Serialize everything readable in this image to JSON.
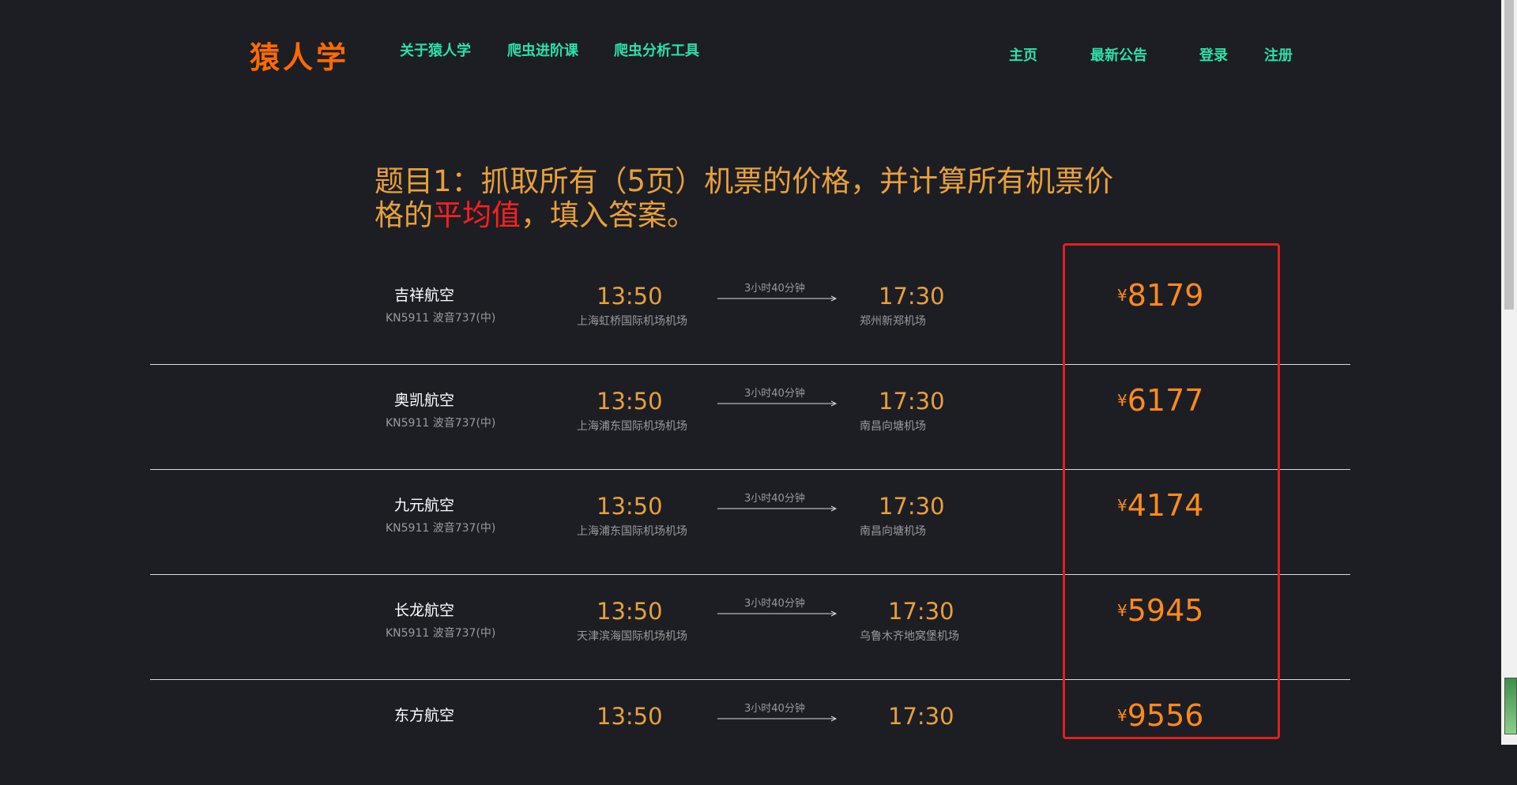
{
  "header": {
    "logo": "猿人学",
    "nav_left": [
      "关于猿人学",
      "爬虫进阶课",
      "爬虫分析工具"
    ],
    "nav_right": [
      "主页",
      "最新公告",
      "登录",
      "注册"
    ]
  },
  "question": {
    "prefix": "题目1：抓取所有（5页）机票的价格，并计算所有机票价格的",
    "emphasis": "平均值",
    "suffix": "，填入答案。"
  },
  "flights": [
    {
      "airline": "吉祥航空",
      "flight_no": "KN5911 波音737(中)",
      "dep_time": "13:50",
      "dep_airport": "上海虹桥国际机场机场",
      "duration": "3小时40分钟",
      "arr_time": "17:30",
      "arr_airport": "郑州新郑机场",
      "currency": "¥",
      "price": "8179"
    },
    {
      "airline": "奥凯航空",
      "flight_no": "KN5911 波音737(中)",
      "dep_time": "13:50",
      "dep_airport": "上海浦东国际机场机场",
      "duration": "3小时40分钟",
      "arr_time": "17:30",
      "arr_airport": "南昌向塘机场",
      "currency": "¥",
      "price": "6177"
    },
    {
      "airline": "九元航空",
      "flight_no": "KN5911 波音737(中)",
      "dep_time": "13:50",
      "dep_airport": "上海浦东国际机场机场",
      "duration": "3小时40分钟",
      "arr_time": "17:30",
      "arr_airport": "南昌向塘机场",
      "currency": "¥",
      "price": "4174"
    },
    {
      "airline": "长龙航空",
      "flight_no": "KN5911 波音737(中)",
      "dep_time": "13:50",
      "dep_airport": "天津滨海国际机场机场",
      "duration": "3小时40分钟",
      "arr_time": "17:30",
      "arr_airport": "乌鲁木齐地窝堡机场",
      "currency": "¥",
      "price": "5945"
    },
    {
      "airline": "东方航空",
      "flight_no": "",
      "dep_time": "13:50",
      "dep_airport": "",
      "duration": "3小时40分钟",
      "arr_time": "17:30",
      "arr_airport": "",
      "currency": "¥",
      "price": "9556"
    }
  ]
}
